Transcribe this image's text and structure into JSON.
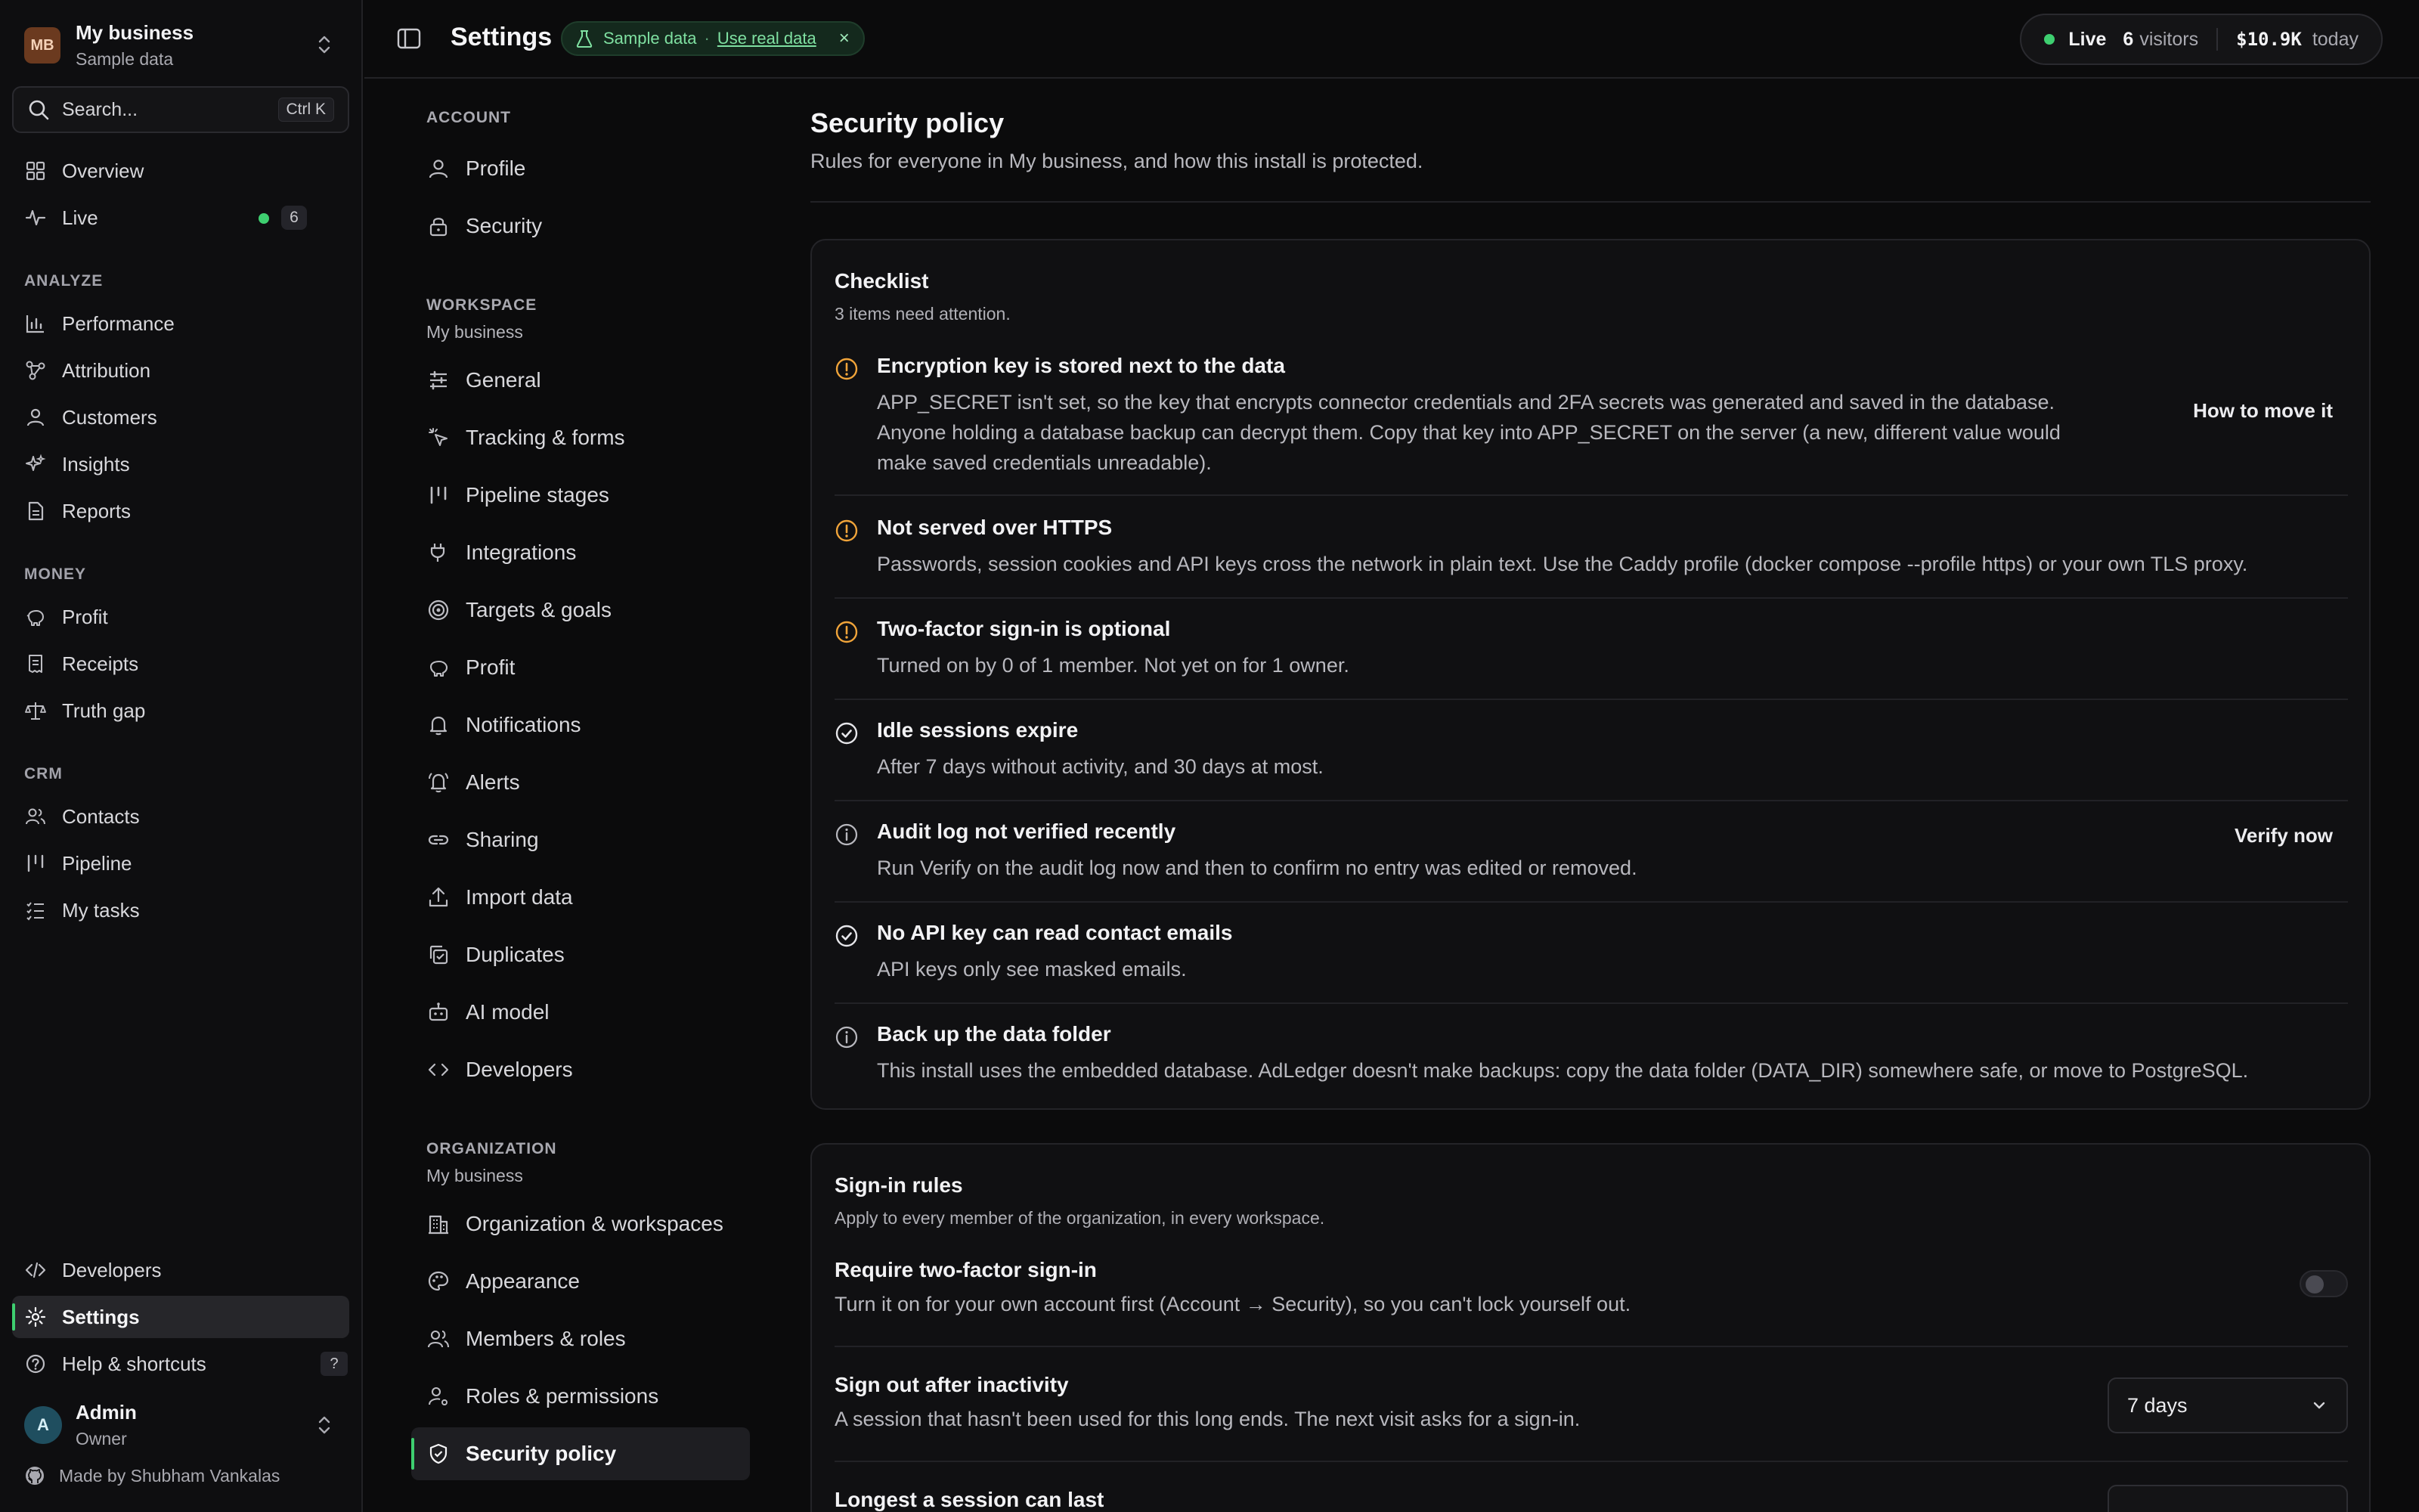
{
  "sidebar": {
    "business_badge": "MB",
    "business_name": "My business",
    "business_sub": "Sample data",
    "search_placeholder": "Search...",
    "search_shortcut": "Ctrl K",
    "overview": "Overview",
    "live": "Live",
    "live_count": "6",
    "analyze_label": "ANALYZE",
    "analyze": [
      "Performance",
      "Attribution",
      "Customers",
      "Insights",
      "Reports"
    ],
    "money_label": "MONEY",
    "money": [
      "Profit",
      "Receipts",
      "Truth gap"
    ],
    "crm_label": "CRM",
    "crm": [
      "Contacts",
      "Pipeline",
      "My tasks"
    ],
    "developers": "Developers",
    "settings": "Settings",
    "help": "Help & shortcuts",
    "help_key": "?",
    "user_initial": "A",
    "user_name": "Admin",
    "user_role": "Owner",
    "made_by": "Made by Shubham Vankalas"
  },
  "topbar": {
    "title": "Settings",
    "sample_label": "Sample data",
    "sample_sep": "·",
    "use_real": "Use real data",
    "close_glyph": "×",
    "live": "Live",
    "visitors_count": "6",
    "visitors_label": "visitors",
    "revenue": "$10.9K",
    "revenue_label": "today"
  },
  "settings_nav": {
    "account_label": "ACCOUNT",
    "account": [
      "Profile",
      "Security"
    ],
    "workspace_label": "WORKSPACE",
    "workspace_sub": "My business",
    "workspace": [
      "General",
      "Tracking & forms",
      "Pipeline stages",
      "Integrations",
      "Targets & goals",
      "Profit",
      "Notifications",
      "Alerts",
      "Sharing",
      "Import data",
      "Duplicates",
      "AI model",
      "Developers"
    ],
    "organization_label": "ORGANIZATION",
    "organization_sub": "My business",
    "organization": [
      "Organization & workspaces",
      "Appearance",
      "Members & roles",
      "Roles & permissions",
      "Security policy"
    ]
  },
  "main": {
    "title": "Security policy",
    "description": "Rules for everyone in My business, and how this install is protected.",
    "checklist": {
      "title": "Checklist",
      "subtitle": "3 items need attention.",
      "items": [
        {
          "status": "warning",
          "title": "Encryption key is stored next to the data",
          "body": [
            "APP_SECRET isn't set, so the key that encrypts connector credentials and 2FA secrets was generated and saved in the database.",
            "Anyone holding a database backup can decrypt them. Copy that key into APP_SECRET on the server (a new, different value would",
            "make saved credentials unreadable)."
          ],
          "action": "How to move it"
        },
        {
          "status": "warning",
          "title": "Not served over HTTPS",
          "body": [
            "Passwords, session cookies and API keys cross the network in plain text. Use the Caddy profile (docker compose --profile https) or your own TLS proxy."
          ]
        },
        {
          "status": "warning",
          "title": "Two-factor sign-in is optional",
          "body": [
            "Turned on by 0 of 1 member. Not yet on for 1 owner."
          ]
        },
        {
          "status": "ok",
          "title": "Idle sessions expire",
          "body": [
            "After 7 days without activity, and 30 days at most."
          ]
        },
        {
          "status": "info",
          "title": "Audit log not verified recently",
          "body": [
            "Run Verify on the audit log now and then to confirm no entry was edited or removed."
          ],
          "action": "Verify now"
        },
        {
          "status": "ok",
          "title": "No API key can read contact emails",
          "body": [
            "API keys only see masked emails."
          ]
        },
        {
          "status": "info",
          "title": "Back up the data folder",
          "body": [
            "This install uses the embedded database. AdLedger doesn't make backups: copy the data folder (DATA_DIR) somewhere safe, or move to PostgreSQL."
          ]
        }
      ]
    },
    "signin": {
      "title": "Sign-in rules",
      "subtitle": "Apply to every member of the organization, in every workspace.",
      "two_factor_title": "Require two-factor sign-in",
      "two_factor_desc": "Turn it on for your own account first (Account → Security), so you can't lock yourself out.",
      "two_factor_enabled": false,
      "inactivity_title": "Sign out after inactivity",
      "inactivity_desc": "A session that hasn't been used for this long ends. The next visit asks for a sign-in.",
      "inactivity_value": "7 days",
      "longest_title": "Longest a session can last"
    }
  },
  "colors": {
    "accent_green": "#3ecf70",
    "warning": "#f0a43a",
    "background": "#0b0b0c"
  }
}
